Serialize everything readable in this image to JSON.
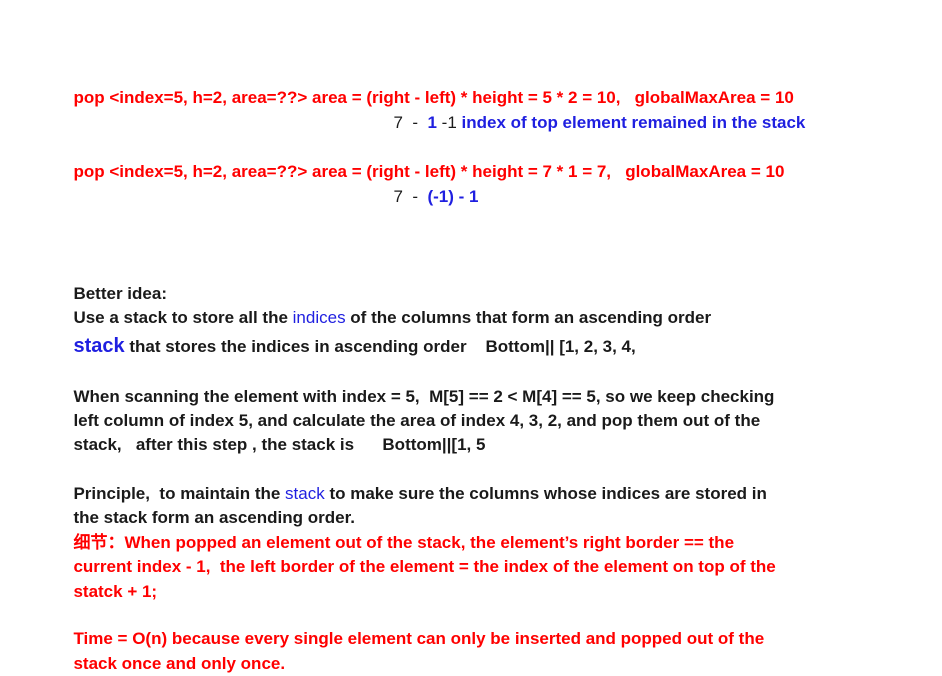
{
  "colors": {
    "red": "#ff0000",
    "blue": "#1f1fe0",
    "black": "#1a1a1a"
  },
  "pop1": {
    "line1": "pop <index=5, h=2, area=??> area = (right - left) * height = 5 * 2 = 10,   globalMaxArea = 10",
    "seven": "7",
    "dash1": "  -  ",
    "one": "1",
    "minus_one": " -1 ",
    "note": "index of top element remained in the stack"
  },
  "pop2": {
    "line1": "pop <index=5, h=2, area=??> area = (right - left) * height = 7 * 1 = 7,   globalMaxArea = 10",
    "seven": "7",
    "dash1": "  -  ",
    "expr": "(-1) - 1"
  },
  "better": {
    "heading": "Better idea:",
    "l1_a": "Use a stack to store all the ",
    "l1_b": "indices",
    "l1_c": " of the columns that form an ascending order",
    "l2_a": "stack",
    "l2_b": " that stores the indices in ascending order    Bottom|| [1, 2, 3, 4,"
  },
  "scan": {
    "l1": "When scanning the element with index = 5,  M[5] == 2 < M[4] == 5, so we keep checking",
    "l2": "left column of index 5, and calculate the area of index 4, 3, 2, and pop them out of the",
    "l3": "stack,   after this step , the stack is      Bottom||[1, 5"
  },
  "principle": {
    "l1_a": "Principle,  to maintain the ",
    "l1_b": "stack",
    "l1_c": " to make sure the columns whose indices are stored in",
    "l2": "the stack form an ascending order.",
    "l3": "细节：When popped an element out of the stack, the element’s right border == the",
    "l4": "current index - 1,  the left border of the element = the index of the element on top of the",
    "l5": "statck + 1;"
  },
  "time": {
    "l1": "Time = O(n) because every single element can only be inserted and popped out of the",
    "l2": "stack once and only once."
  }
}
